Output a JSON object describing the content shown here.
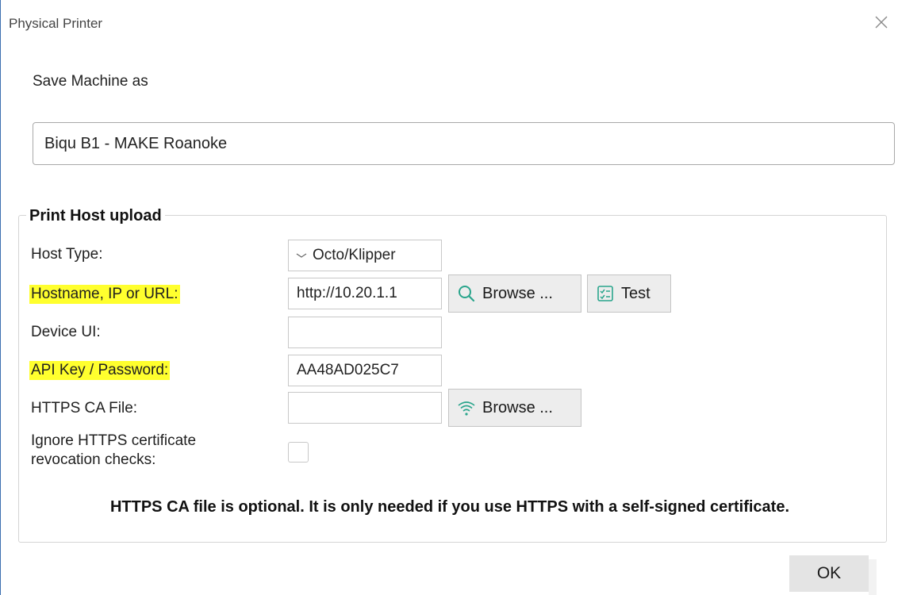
{
  "window": {
    "title": "Physical Printer",
    "close_glyph": "×"
  },
  "save": {
    "label": "Save Machine as",
    "value": "Biqu B1 - MAKE Roanoke"
  },
  "group": {
    "title": "Print Host upload"
  },
  "rows": {
    "host_type": {
      "label": "Host Type:",
      "value": "Octo/Klipper"
    },
    "hostname": {
      "label": "Hostname, IP or URL:",
      "value": "http://10.20.1.1",
      "highlight": "#ffff2e"
    },
    "device_ui": {
      "label": "Device UI:",
      "value": ""
    },
    "api_key": {
      "label": "API Key / Password:",
      "value": "AA48AD025C7",
      "highlight": "#ffff2e"
    },
    "https_ca": {
      "label": "HTTPS CA File:",
      "value": ""
    },
    "ignore_revocation": {
      "label_line1": "Ignore HTTPS certificate",
      "label_line2": "revocation checks:",
      "checked": false
    }
  },
  "buttons": {
    "browse_host": {
      "label": "Browse ...",
      "icon": "search-icon"
    },
    "test": {
      "label": "Test",
      "icon": "checklist-icon"
    },
    "browse_ca": {
      "label": "Browse ...",
      "icon": "wifi-icon"
    },
    "ok": {
      "label": "OK"
    }
  },
  "note": "HTTPS CA file is optional. It is only needed if you use HTTPS with a self-signed certificate.",
  "colors": {
    "icon_accent": "#2aa58c",
    "highlight": "#ffff2e",
    "window_border": "#3c6fb0"
  }
}
